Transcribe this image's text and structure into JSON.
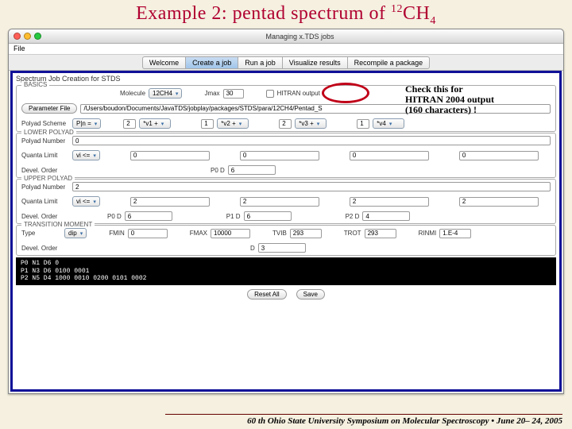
{
  "slide": {
    "title_a": "Example 2: pentad spectrum of ",
    "title_sup": "12",
    "title_b": "CH",
    "title_sub": "4"
  },
  "window": {
    "title": "Managing x.TDS jobs",
    "file_menu": "File"
  },
  "tabs": [
    "Welcome",
    "Create a job",
    "Run a job",
    "Visualize results",
    "Recompile a package"
  ],
  "header_line": "Spectrum Job Creation for STDS",
  "basics": {
    "legend": "BASICS",
    "molecule_lbl": "Molecule",
    "molecule": "12CH4",
    "jmax_lbl": "Jmax",
    "jmax": "30",
    "hitran_lbl": "HITRAN output",
    "param_btn": "Parameter File",
    "param_path": "/Users/boudon/Documents/JavaTDS/jobplay/packages/STDS/para/12CH4/Pentad_S",
    "polyad_lbl": "Polyad Scheme",
    "polyad_sel": "P|n =",
    "p_vals": [
      "2",
      "*v1 +",
      "1",
      "*v2 +",
      "2",
      "*v3 +",
      "1",
      "*v4"
    ]
  },
  "lower": {
    "legend": "LOWER POLYAD",
    "polyad_num_lbl": "Polyad Number",
    "polyad_num": "0",
    "ql_lbl": "Quanta Limit",
    "ql_sel": "vi <=",
    "ql_vals": [
      "0",
      "0",
      "0",
      "0"
    ],
    "dev_lbl": "Devel. Order",
    "p0d": "P0 D",
    "p0d_v": "6"
  },
  "upper": {
    "legend": "UPPER POLYAD",
    "polyad_num_lbl": "Polyad Number",
    "polyad_num": "2",
    "ql_lbl": "Quanta Limit",
    "ql_sel": "vi <=",
    "ql_vals": [
      "2",
      "2",
      "2",
      "2"
    ],
    "dev_lbl": "Devel. Order",
    "p0d": "P0 D",
    "p0d_v": "6",
    "p1d": "P1 D",
    "p1d_v": "6",
    "p2d": "P2 D",
    "p2d_v": "4"
  },
  "trans": {
    "legend": "TRANSITION MOMENT",
    "type_lbl": "Type",
    "type_sel": "dip",
    "fmin_lbl": "FMIN",
    "fmin": "0",
    "fmax_lbl": "FMAX",
    "fmax": "10000",
    "tvib_lbl": "TVIB",
    "tvib": "293",
    "trot_lbl": "TROT",
    "trot": "293",
    "rinmi_lbl": "RINMI",
    "rinmi": "1.E-4",
    "dev_lbl": "Devel. Order",
    "d": "D",
    "d_v": "3"
  },
  "black_lines": [
    "P0 N1  D6 0",
    "P1 N3  D6 0100 0001",
    "P2 N5  D4 1000 0010 0200 0101 0002"
  ],
  "buttons": {
    "reset": "Reset All",
    "save": "Save"
  },
  "callout": {
    "l1": "Check this for",
    "l2": "HITRAN 2004 output",
    "l3": "(160 characters) !"
  },
  "footer": "60 th Ohio State University Symposium on Molecular Spectroscopy • June 20– 24, 2005"
}
